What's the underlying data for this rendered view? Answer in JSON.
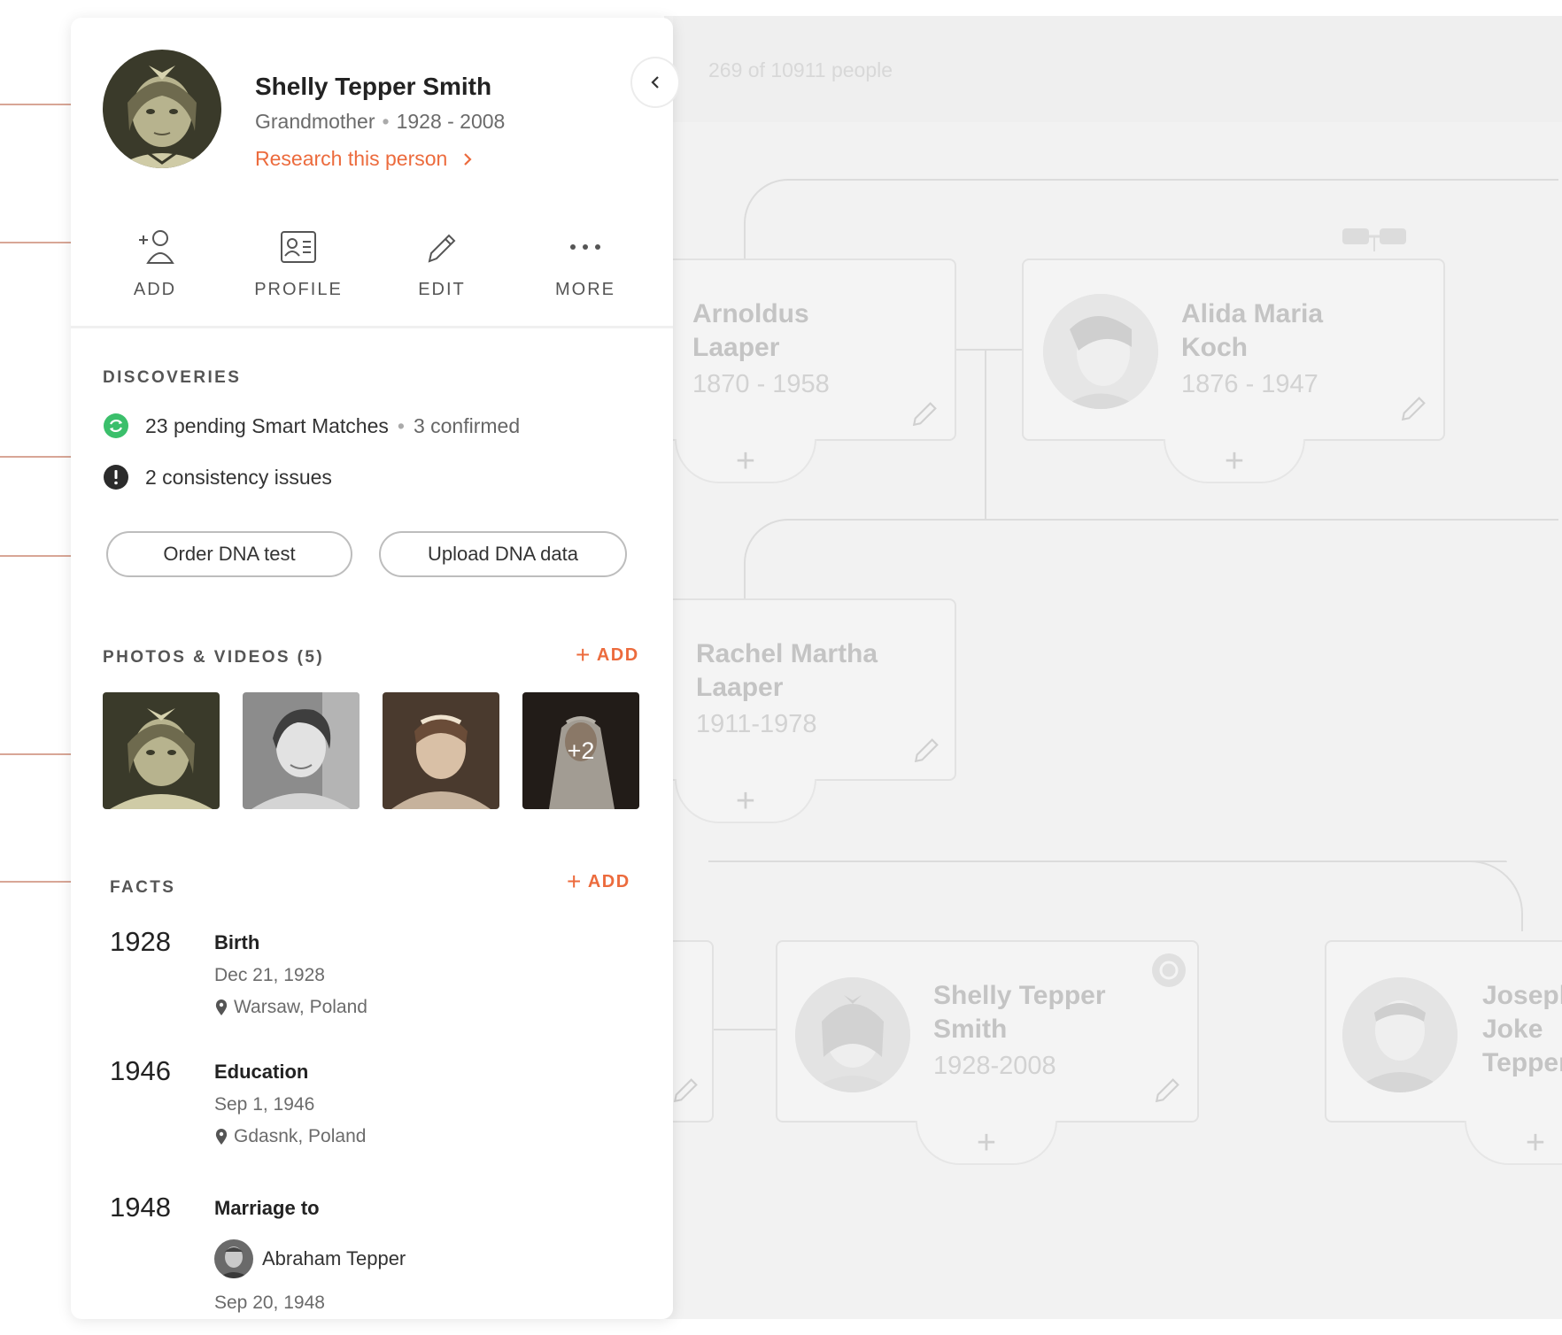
{
  "tree": {
    "people_count": "269 of 10911 people",
    "cards": [
      {
        "name_line1": "Arnoldus",
        "name_line2": "Laaper",
        "dates": "1870 - 1958"
      },
      {
        "name_line1": "Alida Maria",
        "name_line2": "Koch",
        "dates": "1876 - 1947"
      },
      {
        "name_line1": "Rachel Martha",
        "name_line2": "Laaper",
        "dates": "1911-1978"
      },
      {
        "name_line1": "Shelly Tepper",
        "name_line2": "Smith",
        "dates": "1928-2008"
      },
      {
        "name_line1": "Joseph",
        "name_line2": "Joke",
        "name_line3": "Tepper"
      }
    ]
  },
  "panel": {
    "name": "Shelly Tepper Smith",
    "relation": "Grandmother",
    "years": "1928 - 2008",
    "research_link": "Research this person",
    "actions": [
      {
        "label": "ADD",
        "icon": "add-person-icon"
      },
      {
        "label": "PROFILE",
        "icon": "profile-card-icon"
      },
      {
        "label": "EDIT",
        "icon": "pencil-icon"
      },
      {
        "label": "MORE",
        "icon": "more-dots-icon"
      }
    ],
    "discoveries": {
      "title": "DISCOVERIES",
      "smart_matches": "23 pending Smart Matches",
      "confirmed": "3 confirmed",
      "issues": "2 consistency issues",
      "order_dna": "Order DNA test",
      "upload_dna": "Upload DNA data"
    },
    "photos": {
      "title": "PHOTOS & VIDEOS (5)",
      "add_label": "ADD",
      "more_count": "+2"
    },
    "facts": {
      "title": "FACTS",
      "add_label": "ADD",
      "items": [
        {
          "year": "1928",
          "title": "Birth",
          "date": "Dec 21, 1928",
          "place": "Warsaw, Poland"
        },
        {
          "year": "1946",
          "title": "Education",
          "date": "Sep 1, 1946",
          "place": "Gdasnk, Poland"
        },
        {
          "year": "1948",
          "title": "Marriage to",
          "spouse": "Abraham Tepper",
          "date": "Sep 20, 1948"
        }
      ]
    }
  },
  "colors": {
    "accent": "#ec6b3d",
    "match_green": "#3bbf6b",
    "annotation": "#d8a696"
  }
}
